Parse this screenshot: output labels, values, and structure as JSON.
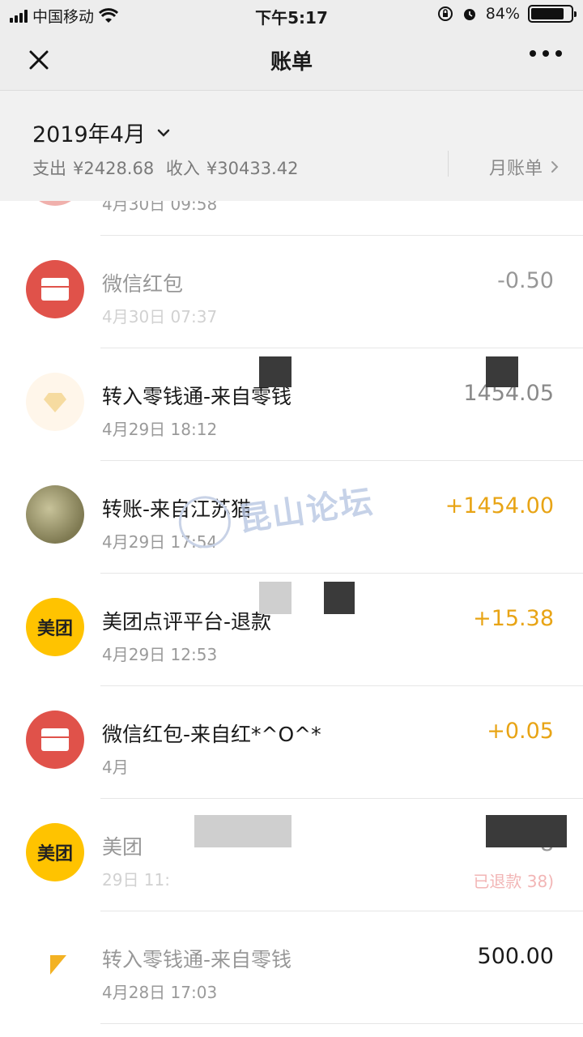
{
  "status_bar": {
    "carrier": "中国移动",
    "time": "下午5:17",
    "battery": "84%",
    "battery_level": 0.84
  },
  "nav": {
    "title": "账单"
  },
  "summary": {
    "month": "2019年4月",
    "expense_label": "支出",
    "expense_value": "¥2428.68",
    "income_label": "收入",
    "income_value": "¥30433.42",
    "monthly_bill": "月账单"
  },
  "transactions": [
    {
      "title": "",
      "time": "4月30日 09:58",
      "amount": ""
    },
    {
      "title": "微信红包",
      "time": "4月30日 07:37",
      "amount": "-0.50"
    },
    {
      "title": "转入零钱通-来自零钱",
      "time": "4月29日 18:12",
      "amount": "1454.05"
    },
    {
      "title": "转账-来自江苏猫",
      "time": "4月29日 17:54",
      "amount": "+1454.00"
    },
    {
      "title": "美团点评平台-退款",
      "time": "4月29日 12:53",
      "amount": "+15.38"
    },
    {
      "title": "微信红包-来自红*^O^*",
      "time": "4月",
      "amount": "+0.05"
    },
    {
      "title": "美团",
      "time": "29日 11:",
      "amount": "8",
      "note": "已退款 38)"
    },
    {
      "title": "转入零钱通-来自零钱",
      "time": "4月28日 17:03",
      "amount": "500.00"
    }
  ],
  "watermark": "昆山论坛",
  "colors": {
    "income": "#e8a415",
    "header_bg": "#ededed",
    "redpack": "#e0524a",
    "meituan": "#ffc300"
  },
  "icons": {
    "close": "close-icon",
    "more": "more-icon",
    "dropdown": "chevron-down-icon",
    "monthly": "chevron-right-icon"
  }
}
